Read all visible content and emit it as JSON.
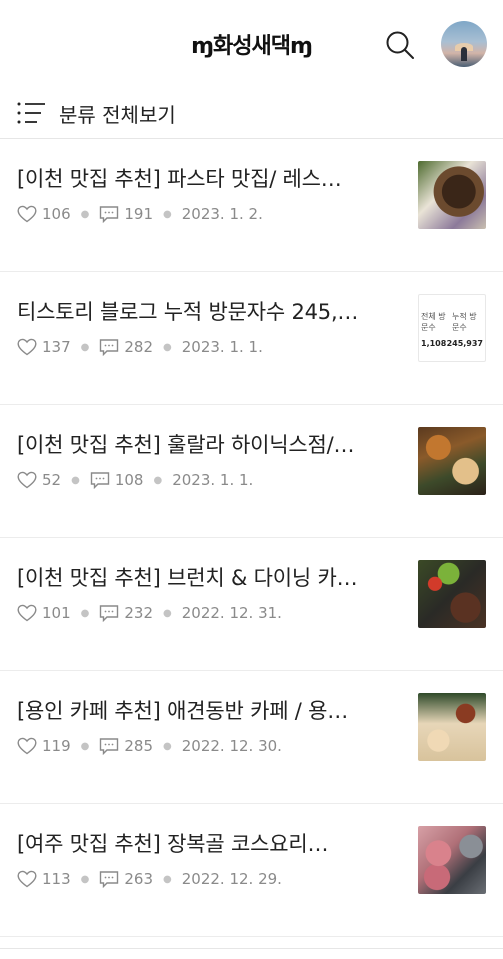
{
  "header": {
    "blog_title": "ɱ화성새댁ɱ",
    "search_icon": "search-icon",
    "avatar_icon": "profile-avatar"
  },
  "category_bar": {
    "icon": "list-menu-icon",
    "label": "분류 전체보기"
  },
  "posts": [
    {
      "title": "[이천 맛집 추천] 파스타 맛집/ 레스…",
      "likes": "106",
      "comments": "191",
      "date": "2023. 1. 2."
    },
    {
      "title": "티스토리 블로그 누적 방문자수 245,…",
      "likes": "137",
      "comments": "282",
      "date": "2023. 1. 1.",
      "thumb": {
        "col1": "전체 방문수",
        "col2": "누적 방문수",
        "val1": "1,108",
        "val2": "245,937"
      }
    },
    {
      "title": "[이천 맛집 추천] 훌랄라 하이닉스점/…",
      "likes": "52",
      "comments": "108",
      "date": "2023. 1. 1."
    },
    {
      "title": "[이천 맛집 추천] 브런치 & 다이닝 카…",
      "likes": "101",
      "comments": "232",
      "date": "2022. 12. 31."
    },
    {
      "title": "[용인 카페 추천] 애견동반 카페 / 용…",
      "likes": "119",
      "comments": "285",
      "date": "2022. 12. 30."
    },
    {
      "title": "[여주 맛집 추천]  장복골 코스요리…",
      "likes": "113",
      "comments": "263",
      "date": "2022. 12. 29."
    }
  ],
  "colors": {
    "text": "#222222",
    "meta": "#8a8a8a",
    "divider": "#ececec"
  }
}
